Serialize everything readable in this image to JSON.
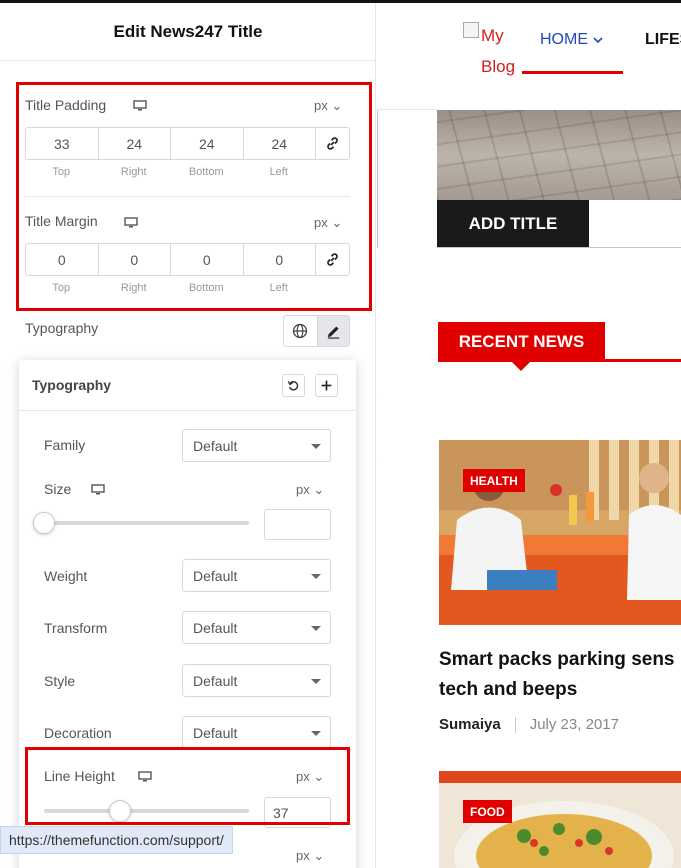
{
  "panel": {
    "title": "Edit News247 Title",
    "title_padding": {
      "label": "Title Padding",
      "unit": "px ⌄",
      "values": [
        "33",
        "24",
        "24",
        "24"
      ],
      "sides": [
        "Top",
        "Right",
        "Bottom",
        "Left"
      ]
    },
    "title_margin": {
      "label": "Title Margin",
      "unit": "px ⌄",
      "values": [
        "0",
        "0",
        "0",
        "0"
      ],
      "sides": [
        "Top",
        "Right",
        "Bottom",
        "Left"
      ]
    },
    "typography_label": "Typography"
  },
  "typography_popover": {
    "title": "Typography",
    "family": {
      "label": "Family",
      "value": "Default"
    },
    "size": {
      "label": "Size",
      "unit": "px ⌄",
      "value": "",
      "slider_fraction": 0
    },
    "weight": {
      "label": "Weight",
      "value": "Default"
    },
    "transform": {
      "label": "Transform",
      "value": "Default"
    },
    "style": {
      "label": "Style",
      "value": "Default"
    },
    "decoration": {
      "label": "Decoration",
      "value": "Default"
    },
    "line_height": {
      "label": "Line Height",
      "unit": "px ⌄",
      "value": "37",
      "slider_fraction": 0.37
    },
    "next_unit": "px ⌄"
  },
  "status_bar": {
    "url": "https://themefunction.com/support/"
  },
  "preview": {
    "logo_alt": "My Blog",
    "nav": {
      "home": "HOME",
      "next": "LIFES"
    },
    "add_title": "ADD TITLE",
    "recent_news": "RECENT NEWS",
    "post1": {
      "category": "HEALTH",
      "title_line1": "Smart packs parking sens",
      "title_line2": "tech and beeps",
      "author": "Sumaiya",
      "date": "July 23, 2017"
    },
    "post2": {
      "category": "FOOD"
    }
  },
  "colors": {
    "highlight": "#e00000",
    "accent_blue": "#1d4bb8",
    "recent_red": "#e00000"
  }
}
